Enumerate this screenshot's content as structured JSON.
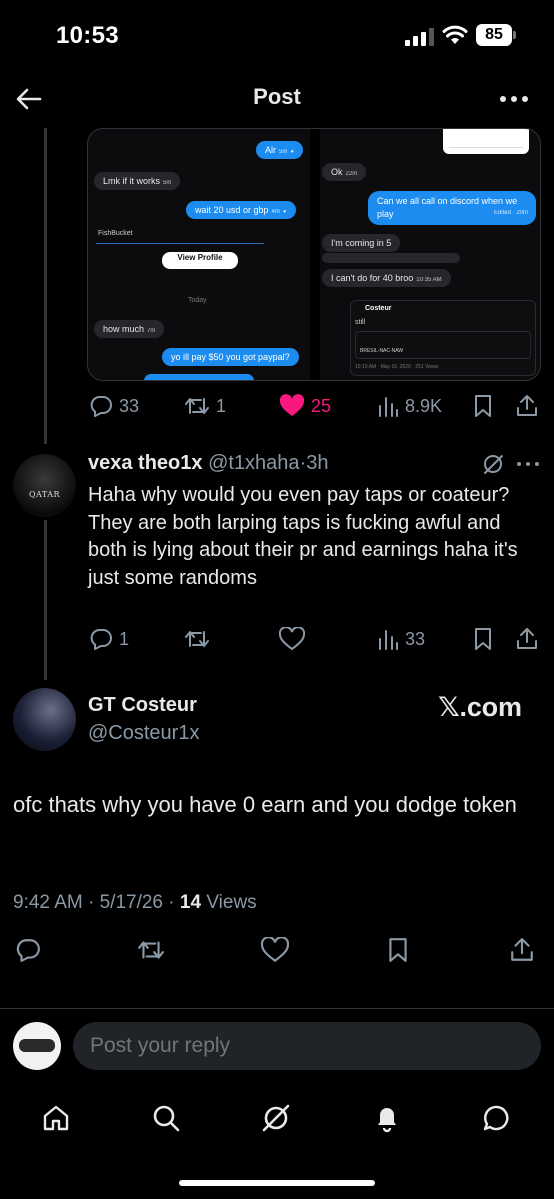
{
  "status_bar": {
    "time": "10:53",
    "battery": "85"
  },
  "header": {
    "title": "Post"
  },
  "media": {
    "left_messages": {
      "alr": "Alr",
      "alr_time": "5m",
      "lmk": "Lmk if it works",
      "lmk_time": "5m",
      "wait": "wait 20 usd or gbp",
      "wait_time": "4m",
      "fish_bucket": "FishBucket",
      "view_profile": "View Profile",
      "today": "Today",
      "how_much": "how much",
      "how_much_time": "7m",
      "paypal": "yo ill pay $50 you got paypal?"
    },
    "right_messages": {
      "ok": "Ok",
      "ok_time": "22m",
      "discord": "Can we all call on discord when we play",
      "discord_meta": "Edited · 20m",
      "coming": "I'm coming in 5",
      "cant": "I can't do for 40 broo",
      "cant_time": "10:35 AM",
      "card_name": "Costeur",
      "card_text": "still",
      "card_quote": "BRESIL-NAC-NAW",
      "card_footer": "10:10 AM · May 16, 2026 · 251 Views"
    }
  },
  "post_actions": {
    "replies": "33",
    "reposts": "1",
    "likes": "25",
    "views": "8.9K"
  },
  "reply": {
    "name": "vexa theo1x",
    "handle": "@t1xhaha",
    "time": "3h",
    "text": "Haha why would you even pay taps or coateur? They are both larping taps is fucking awful and both is lying about their pr and earnings haha it's just some randoms",
    "replies": "1",
    "views": "33",
    "avatar_text": "QATAR"
  },
  "main_post": {
    "name": "GT Costeur",
    "handle": "@Costeur1x",
    "source": "𝕏.com",
    "text": "ofc thats why you have 0 earn and you dodge token",
    "time": "9:42 AM",
    "date": "5/17/26",
    "views_count": "14",
    "views_label": "Views"
  },
  "reply_bar": {
    "placeholder": "Post your reply"
  },
  "icons": {
    "back": "back-arrow-icon",
    "more": "more-dots-icon",
    "reply": "reply-icon",
    "repost": "repost-icon",
    "like": "heart-icon",
    "views": "views-icon",
    "bookmark": "bookmark-icon",
    "share": "share-icon",
    "grok": "grok-icon",
    "home": "home-icon",
    "search": "search-icon",
    "notifications": "bell-icon",
    "messages": "messages-icon"
  },
  "colors": {
    "accent": "#1d9bf0",
    "like": "#f91880",
    "muted": "#8b98a5",
    "background": "#000000"
  }
}
